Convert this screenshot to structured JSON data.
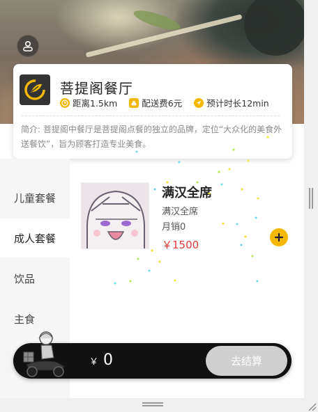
{
  "shop": {
    "name": "菩提阁餐厅",
    "distance": "距离1.5km",
    "delivery_fee": "配送费6元",
    "estimated_time": "预计时长12min",
    "intro": "简介: 菩提阁中餐厅是菩提阁点餐的独立的品牌，定位“大众化的美食外送餐饮”，旨为顾客打造专业美食。"
  },
  "categories": [
    {
      "label": "儿童套餐",
      "active": false
    },
    {
      "label": "成人套餐",
      "active": true
    },
    {
      "label": "饮品",
      "active": false
    },
    {
      "label": "主食",
      "active": false
    }
  ],
  "food": {
    "name": "满汉全席",
    "desc": "满汉全席",
    "sales": "月销0",
    "price": "￥1500"
  },
  "cart": {
    "currency": "￥",
    "total": "0",
    "checkout_label": "去结算"
  },
  "colors": {
    "accent": "#f5b800",
    "price": "#e03a3a",
    "cartbar": "#111111",
    "checkout_disabled": "#cfcfcf"
  },
  "icons": {
    "user": "user-icon",
    "logo": "shop-logo",
    "distance": "clock-icon",
    "fee": "money-bag-icon",
    "time": "navigation-icon",
    "add": "plus-icon",
    "rider": "delivery-rider-icon"
  }
}
